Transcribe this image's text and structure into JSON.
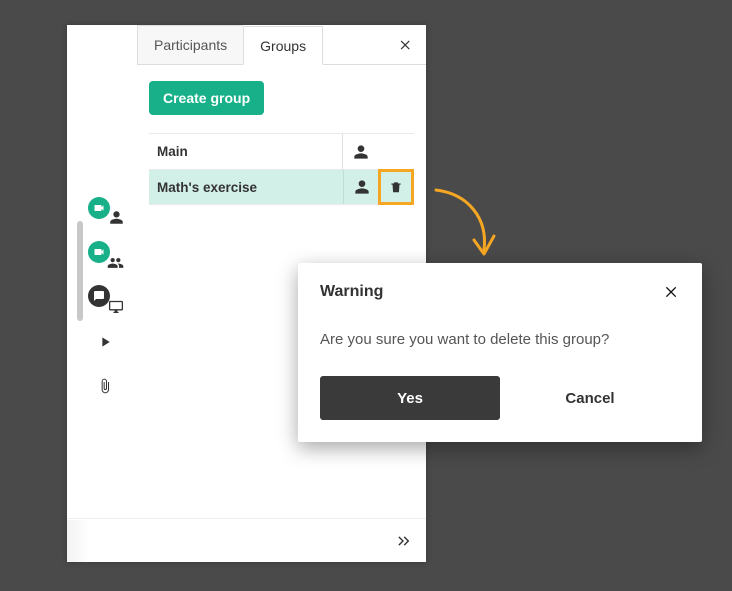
{
  "tabs": {
    "participants": "Participants",
    "groups": "Groups"
  },
  "create_group_label": "Create group",
  "groups_list": [
    {
      "name": "Main"
    },
    {
      "name": "Math's exercise"
    }
  ],
  "modal": {
    "title": "Warning",
    "message": "Are you sure you want to delete this group?",
    "yes": "Yes",
    "cancel": "Cancel"
  },
  "colors": {
    "accent": "#17b089",
    "highlight": "#f5a623"
  }
}
